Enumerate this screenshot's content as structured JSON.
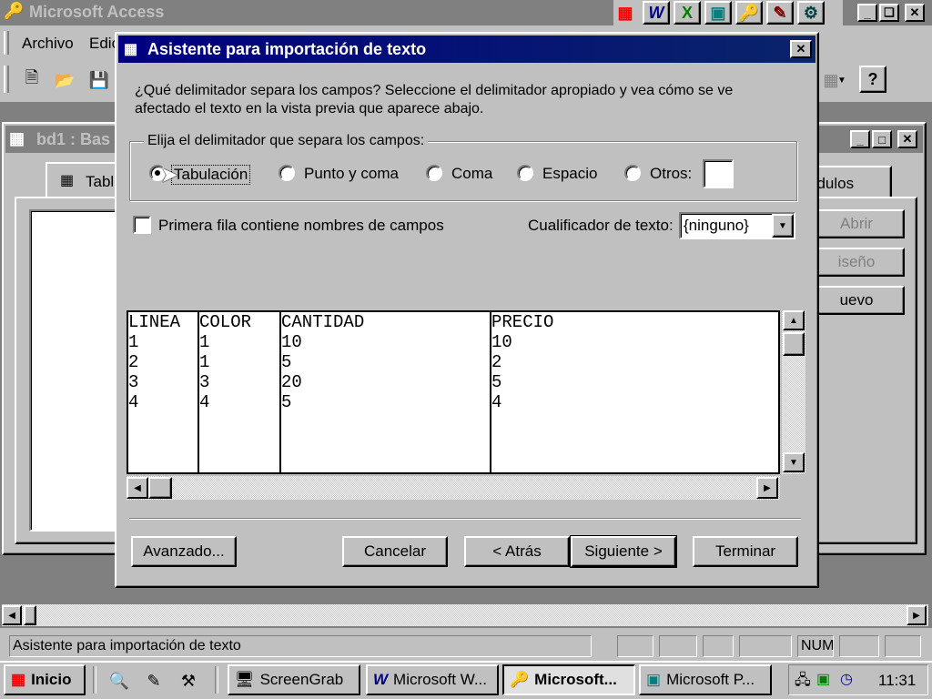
{
  "app": {
    "title": "Microsoft Access",
    "menu": [
      "Archivo",
      "Edic"
    ]
  },
  "db_window": {
    "title": "bd1 : Bas",
    "tabs": {
      "tables": "Tabl",
      "modules": "ódulos"
    },
    "buttons": {
      "open": "Abrir",
      "design": "iseño",
      "new": "uevo"
    }
  },
  "dialog": {
    "title": "Asistente para importación de texto",
    "instruction_line1": "¿Qué delimitador separa los campos? Seleccione el delimitador apropiado y vea cómo se ve",
    "instruction_line2": "afectado el texto en la vista previa que aparece abajo.",
    "group_label": "Elija el delimitador que separa los campos:",
    "delimiters": {
      "tab": "Tabulación",
      "semicolon": "Punto y coma",
      "comma": "Coma",
      "space": "Espacio",
      "other": "Otros:"
    },
    "selected_delimiter": "Tabulación",
    "other_value": "",
    "first_row_label": "Primera fila contiene nombres de campos",
    "first_row_checked": false,
    "qualifier_label": "Cualificador de texto:",
    "qualifier_value": "{ninguno}",
    "preview": {
      "columns": [
        "LINEA",
        "COLOR",
        "CANTIDAD",
        "PRECIO"
      ],
      "rows": [
        [
          "1",
          "1",
          "10",
          "10"
        ],
        [
          "2",
          "1",
          "5",
          "2"
        ],
        [
          "3",
          "3",
          "20",
          "5"
        ],
        [
          "4",
          "4",
          "5",
          "4"
        ]
      ]
    },
    "buttons": {
      "advanced": "Avanzado...",
      "cancel": "Cancelar",
      "back": "< Atrás",
      "next": "Siguiente >",
      "finish": "Terminar"
    }
  },
  "statusbar": {
    "text": "Asistente para importación de texto",
    "num": "NUM"
  },
  "taskbar": {
    "start": "Inicio",
    "tasks": [
      "ScreenGrab",
      "Microsoft W...",
      "Microsoft...",
      "Microsoft P..."
    ],
    "active_task": "Microsoft...",
    "clock": "11:31"
  },
  "colors": {
    "face": "#c0c0c0",
    "active_title": "#000080",
    "inactive_title": "#808080"
  }
}
